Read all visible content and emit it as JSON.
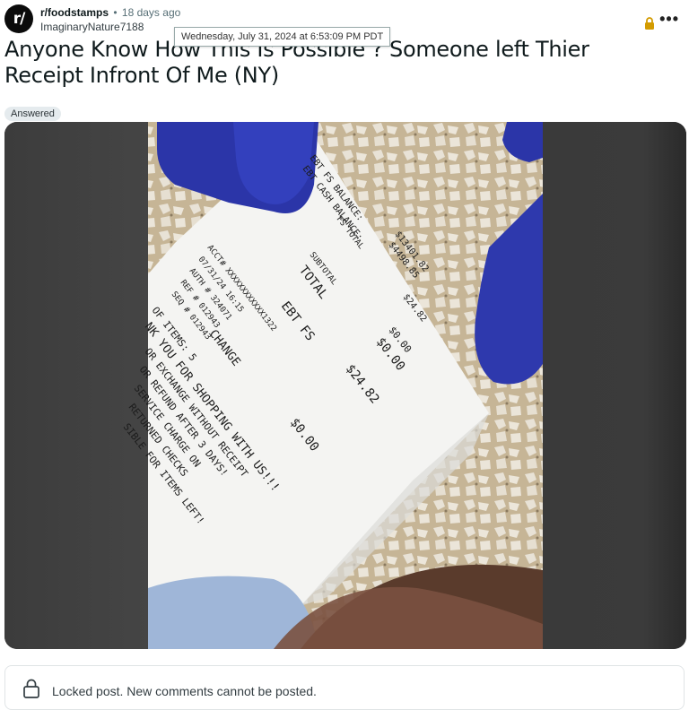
{
  "post": {
    "subreddit": "r/foodstamps",
    "separator": "•",
    "age": "18 days ago",
    "author": "ImaginaryNature7188",
    "timestamp_tooltip": "Wednesday, July 31, 2024 at 6:53:09 PM PDT",
    "title": "Anyone Know How This Is Possible ? Someone left Thier Receipt Infront Of Me (NY)",
    "flair": "Answered",
    "more_label": "•••"
  },
  "avatar": {
    "label": "r/"
  },
  "receipt": {
    "lines": [
      "EBT FS BALANCE:",
      "EBT CASH BALANCE:",
      "$13401.82",
      "$4498.85",
      "FS TOTAL",
      "$24.82",
      "SUBTOTAL",
      "TOTAL",
      "$0.00",
      "$0.00",
      "EBT FS",
      "$24.82",
      "ACCT# XXXXXXXXXXXX1322",
      "07/31/24   16:15",
      "AUTH # 324071",
      "REF # 012943",
      "SEQ # 012943",
      "CHANGE",
      "$0.00",
      "OF ITEMS: 5",
      "NK YOU FOR SHOPPING WITH US!!!",
      "OR EXCHANGE WITHOUT RECEIPT",
      "OR REFUND AFTER 3 DAYS!",
      "SERVICE CHARGE ON",
      "RETURNED CHECKS",
      "SIBLE FOR ITEMS LEFT!"
    ]
  },
  "locked": {
    "message": "Locked post. New comments cannot be posted."
  },
  "colors": {
    "glove": "#2b35a8",
    "counter": "#c9b89a",
    "paper": "#f4f4f2"
  },
  "icons": {
    "lock_top": "lock-icon",
    "more": "more-icon",
    "locked": "lock-icon"
  }
}
